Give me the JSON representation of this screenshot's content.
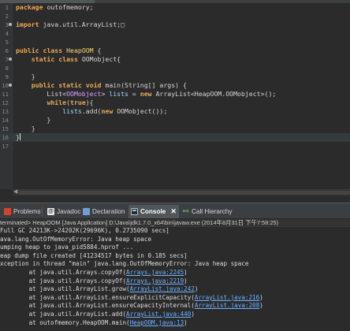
{
  "editor": {
    "lines": [
      {
        "n": "1",
        "fold": false,
        "current": false,
        "parts": [
          {
            "t": "package",
            "c": "kw"
          },
          {
            "t": " outofmemory;",
            "c": ""
          }
        ]
      },
      {
        "n": "2",
        "fold": false,
        "current": false,
        "parts": []
      },
      {
        "n": "3",
        "fold": true,
        "current": false,
        "parts": [
          {
            "t": "import",
            "c": "kw"
          },
          {
            "t": " java.util.ArrayList;",
            "c": ""
          },
          {
            "t": "□",
            "c": ""
          }
        ]
      },
      {
        "n": "4",
        "fold": false,
        "current": false,
        "parts": []
      },
      {
        "n": "5",
        "fold": false,
        "current": false,
        "parts": []
      },
      {
        "n": "6",
        "fold": false,
        "current": false,
        "parts": [
          {
            "t": "public",
            "c": "kw"
          },
          {
            "t": " ",
            "c": ""
          },
          {
            "t": "class",
            "c": "kw"
          },
          {
            "t": " ",
            "c": ""
          },
          {
            "t": "HeapOOM",
            "c": "ty"
          },
          {
            "t": " {",
            "c": ""
          }
        ]
      },
      {
        "n": "7",
        "fold": true,
        "current": false,
        "parts": [
          {
            "t": "    ",
            "c": ""
          },
          {
            "t": "static",
            "c": "kw"
          },
          {
            "t": " ",
            "c": ""
          },
          {
            "t": "class",
            "c": "kw"
          },
          {
            "t": " OOMobject{",
            "c": ""
          }
        ]
      },
      {
        "n": "8",
        "fold": false,
        "current": false,
        "parts": []
      },
      {
        "n": "9",
        "fold": false,
        "current": false,
        "parts": [
          {
            "t": "    }",
            "c": ""
          }
        ]
      },
      {
        "n": "10",
        "fold": true,
        "current": false,
        "parts": [
          {
            "t": "    ",
            "c": ""
          },
          {
            "t": "public",
            "c": "kw"
          },
          {
            "t": " ",
            "c": ""
          },
          {
            "t": "static",
            "c": "kw"
          },
          {
            "t": " ",
            "c": ""
          },
          {
            "t": "void",
            "c": "kw"
          },
          {
            "t": " main(String[] args) {",
            "c": ""
          }
        ]
      },
      {
        "n": "11",
        "fold": false,
        "current": false,
        "parts": [
          {
            "t": "        List<",
            "c": ""
          },
          {
            "t": "OOMobject",
            "c": "tp"
          },
          {
            "t": "> ",
            "c": ""
          },
          {
            "t": "lists",
            "c": "fi"
          },
          {
            "t": " = ",
            "c": ""
          },
          {
            "t": "new",
            "c": "kw"
          },
          {
            "t": " ArrayList<HeapOOM.OOMobject>();",
            "c": ""
          }
        ]
      },
      {
        "n": "12",
        "fold": false,
        "current": false,
        "parts": [
          {
            "t": "        ",
            "c": ""
          },
          {
            "t": "while",
            "c": "kw"
          },
          {
            "t": "(",
            "c": ""
          },
          {
            "t": "true",
            "c": "kw"
          },
          {
            "t": "){",
            "c": ""
          }
        ]
      },
      {
        "n": "13",
        "fold": false,
        "current": false,
        "parts": [
          {
            "t": "            ",
            "c": ""
          },
          {
            "t": "lists",
            "c": "fi"
          },
          {
            "t": ".add(",
            "c": ""
          },
          {
            "t": "new",
            "c": "kw"
          },
          {
            "t": " OOMobject());",
            "c": ""
          }
        ]
      },
      {
        "n": "14",
        "fold": false,
        "current": false,
        "parts": [
          {
            "t": "        }",
            "c": ""
          }
        ]
      },
      {
        "n": "15",
        "fold": false,
        "current": false,
        "parts": [
          {
            "t": "    }",
            "c": ""
          }
        ]
      },
      {
        "n": "16",
        "fold": false,
        "current": true,
        "parts": [
          {
            "t": "}",
            "c": ""
          }
        ]
      },
      {
        "n": "17",
        "fold": false,
        "current": false,
        "parts": []
      }
    ]
  },
  "views": {
    "tabs": [
      {
        "id": "problems",
        "label": "Problems",
        "icon": "problems-icon",
        "active": false
      },
      {
        "id": "javadoc",
        "label": "Javadoc",
        "icon": "javadoc-icon",
        "active": false
      },
      {
        "id": "declaration",
        "label": "Declaration",
        "icon": "declaration-icon",
        "active": false
      },
      {
        "id": "console",
        "label": "Console",
        "icon": "console-icon",
        "active": true
      },
      {
        "id": "call-hierarchy",
        "label": "Call Hierarchy",
        "icon": "call-hierarchy-icon",
        "active": false
      }
    ]
  },
  "console": {
    "header": "terminated> HeapOOM [Java Application] D:\\Java\\jdk1.7.0_x64\\bin\\javaw.exe (2014年8月31日 下午7:58:25)",
    "lines": [
      [
        {
          "t": "Full GC 24213K->24202K(29696K), 0.2735090 secs]",
          "link": false
        }
      ],
      [
        {
          "t": "ava.lang.OutOfMemoryError: Java heap space",
          "link": false
        }
      ],
      [
        {
          "t": "umping heap to java_pid5884.hprof ...",
          "link": false
        }
      ],
      [
        {
          "t": "eap dump file created [41234517 bytes in 0.185 secs]",
          "link": false
        }
      ],
      [
        {
          "t": "xception in thread \"main\" java.lang.OutOfMemoryError: Java heap space",
          "link": false
        }
      ],
      [
        {
          "t": "        at java.util.Arrays.copyOf(",
          "link": false
        },
        {
          "t": "Arrays.java:2245",
          "link": true
        },
        {
          "t": ")",
          "link": false
        }
      ],
      [
        {
          "t": "        at java.util.Arrays.copyOf(",
          "link": false
        },
        {
          "t": "Arrays.java:2219",
          "link": true
        },
        {
          "t": ")",
          "link": false
        }
      ],
      [
        {
          "t": "        at java.util.ArrayList.grow(",
          "link": false
        },
        {
          "t": "ArrayList.java:242",
          "link": true
        },
        {
          "t": ")",
          "link": false
        }
      ],
      [
        {
          "t": "        at java.util.ArrayList.ensureExplicitCapacity(",
          "link": false
        },
        {
          "t": "ArrayList.java:216",
          "link": true
        },
        {
          "t": ")",
          "link": false
        }
      ],
      [
        {
          "t": "        at java.util.ArrayList.ensureCapacityInternal(",
          "link": false
        },
        {
          "t": "ArrayList.java:208",
          "link": true
        },
        {
          "t": ")",
          "link": false
        }
      ],
      [
        {
          "t": "        at java.util.ArrayList.add(",
          "link": false
        },
        {
          "t": "ArrayList.java:440",
          "link": true
        },
        {
          "t": ")",
          "link": false
        }
      ],
      [
        {
          "t": "        at outofmemory.HeapOOM.main(",
          "link": false
        },
        {
          "t": "HeapOOM.java:13",
          "link": true
        },
        {
          "t": ")",
          "link": false
        }
      ]
    ]
  }
}
